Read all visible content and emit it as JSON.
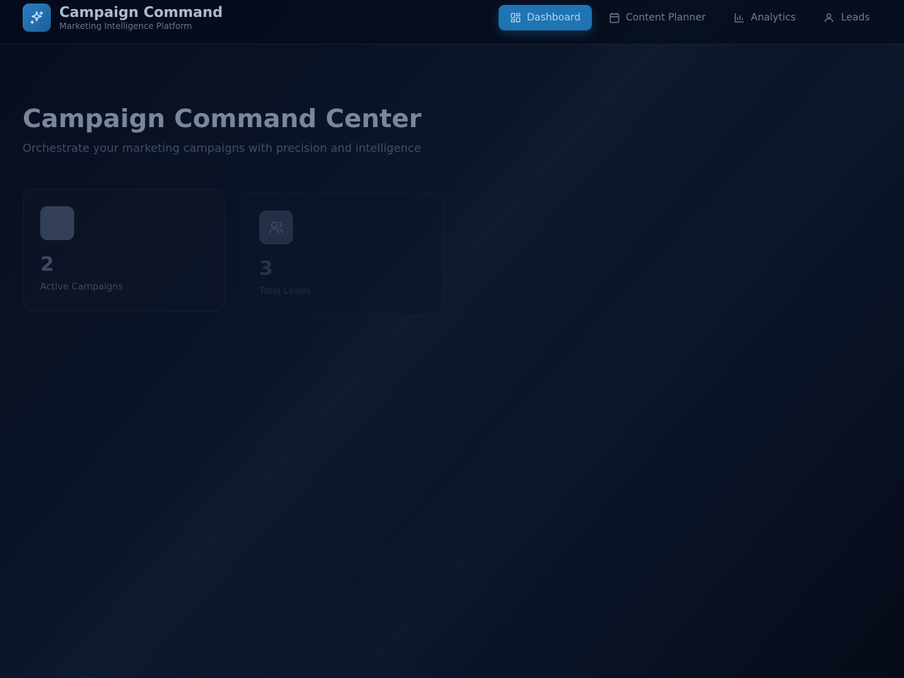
{
  "app": {
    "title": "Campaign Command",
    "subtitle": "Marketing Intelligence Platform"
  },
  "nav": {
    "items": [
      {
        "label": "Dashboard",
        "icon": "grid-icon",
        "active": true
      },
      {
        "label": "Content Planner",
        "icon": "calendar-icon",
        "active": false
      },
      {
        "label": "Analytics",
        "icon": "bar-chart-icon",
        "active": false
      },
      {
        "label": "Leads",
        "icon": "user-icon",
        "active": false
      }
    ]
  },
  "hero": {
    "title": "Campaign Command Center",
    "subtitle": "Orchestrate your marketing campaigns with precision and intelligence"
  },
  "stats": [
    {
      "value": "2",
      "label": "Active Campaigns",
      "icon": "campaign-icon"
    },
    {
      "value": "3",
      "label": "Total Leads",
      "icon": "users-icon"
    }
  ],
  "colors": {
    "accent": "#1f74b3",
    "background": "#0b1528"
  }
}
